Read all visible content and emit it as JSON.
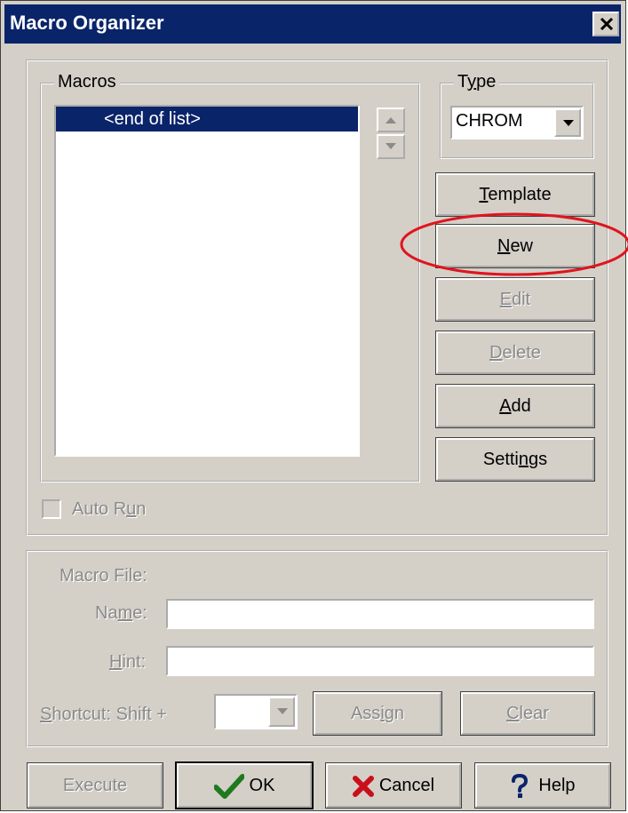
{
  "window": {
    "title": "Macro Organizer"
  },
  "macros_group": {
    "label": "Macros",
    "list_items": [
      "<end of list>"
    ]
  },
  "type_group": {
    "label": "Type",
    "selected": "CHROM"
  },
  "buttons": {
    "template": "Template",
    "new": "New",
    "edit": "Edit",
    "delete": "Delete",
    "add": "Add",
    "settings": "Settings"
  },
  "auto_run": {
    "label": "Auto Run",
    "checked": false
  },
  "macro_file": {
    "heading": "Macro File:",
    "name_label": "Name:",
    "name_value": "",
    "hint_label": "Hint:",
    "hint_value": "",
    "shortcut_label": "Shortcut: Shift +",
    "shortcut_value": "",
    "assign_label": "Assign",
    "clear_label": "Clear"
  },
  "footer": {
    "execute": "Execute",
    "ok": "OK",
    "cancel": "Cancel",
    "help": "Help"
  },
  "colors": {
    "titlebar": "#0a246a",
    "face": "#d4d0c8",
    "highlight_ring": "#e0141e"
  }
}
